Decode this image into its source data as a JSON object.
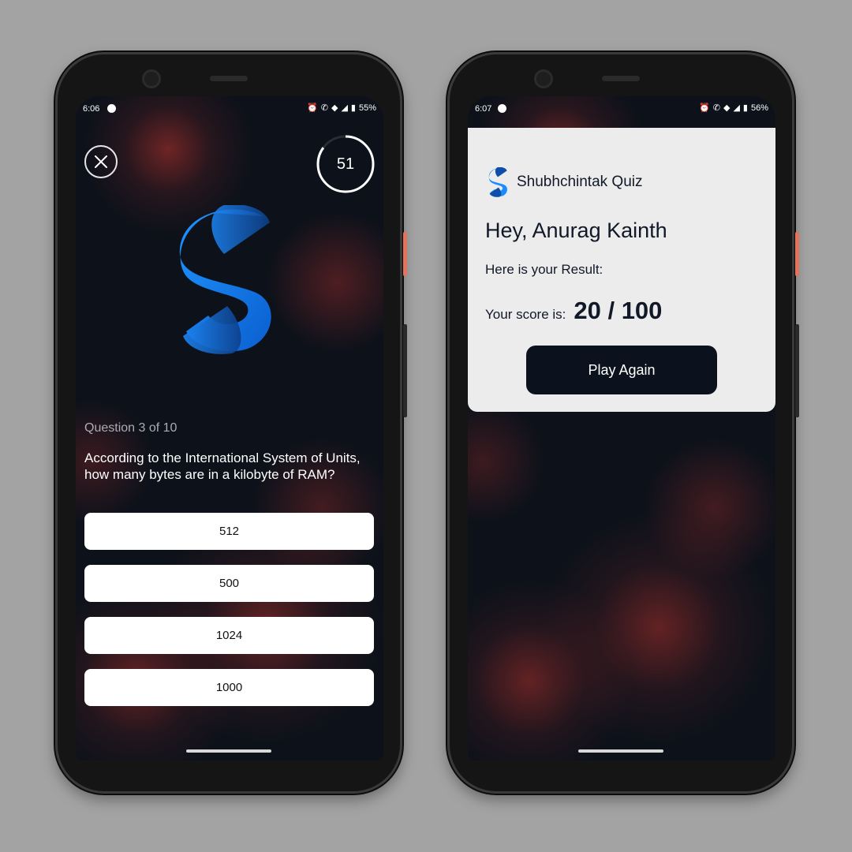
{
  "colors": {
    "background": "#a3a3a3",
    "screen_bg": "#0c111a",
    "fractal_accent": "#e63c32",
    "logo_blue": "#1a8cff",
    "card_bg": "#ececec",
    "button_dark": "#0c121d"
  },
  "quiz_screen": {
    "status": {
      "time": "6:06",
      "battery": "55%"
    },
    "close_icon": "close-icon",
    "timer": {
      "value": "51",
      "progress": 0.85
    },
    "question_counter": "Question 3 of 10",
    "question": "According to the International System of Units, how many bytes are in a kilobyte of RAM?",
    "options": [
      "512",
      "500",
      "1024",
      "1000"
    ]
  },
  "result_screen": {
    "status": {
      "time": "6:07",
      "battery": "56%"
    },
    "app_name": "Shubhchintak Quiz",
    "greeting": "Hey, Anurag Kainth",
    "result_label": "Here is your Result:",
    "score_label": "Your score is:",
    "score_value": "20 / 100",
    "play_again_label": "Play Again"
  }
}
